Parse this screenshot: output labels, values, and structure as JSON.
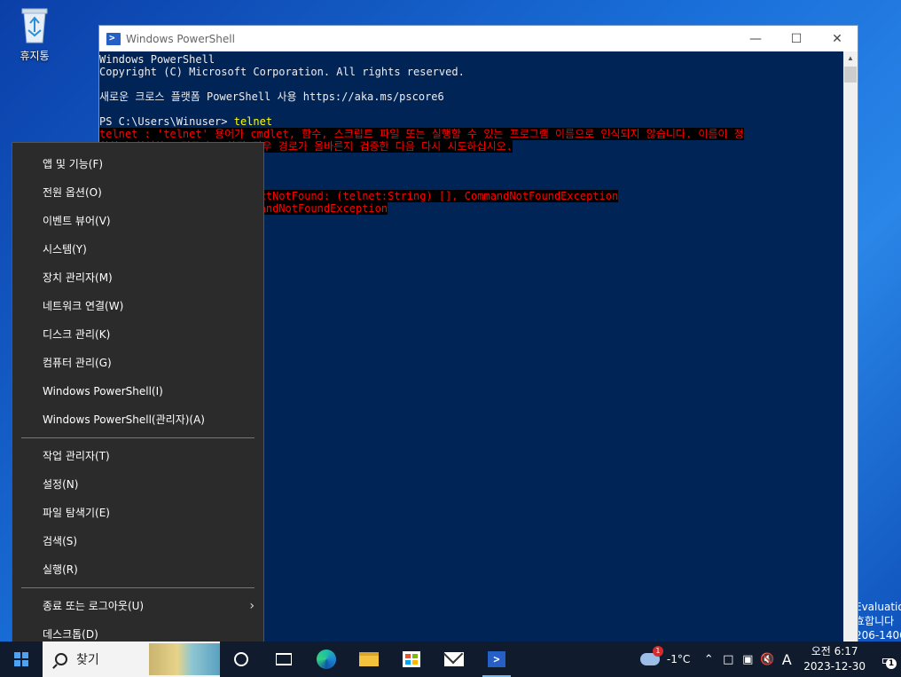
{
  "desktop": {
    "recycle_bin_label": "휴지통"
  },
  "watermark": {
    "lines": [
      "Evaluation",
      "효합니다",
      "206-1406"
    ]
  },
  "powershell": {
    "title": "Windows PowerShell",
    "console_lines": [
      {
        "text": "Windows PowerShell",
        "kind": "normal"
      },
      {
        "text": "Copyright (C) Microsoft Corporation. All rights reserved.",
        "kind": "normal"
      },
      {
        "text": "",
        "kind": "normal"
      },
      {
        "text": "새로운 크로스 플랫폼 PowerShell 사용 https://aka.ms/pscore6",
        "kind": "normal"
      },
      {
        "text": "",
        "kind": "normal"
      },
      {
        "text": "PS C:\\Users\\Winuser> ",
        "kind": "prompt",
        "command": "telnet"
      },
      {
        "text": "telnet : 'telnet' 용어가 cmdlet, 함수, 스크립트 파일 또는 실행할 수 있는 프로그램 이름으로 인식되지 않습니다. 이름이 정",
        "kind": "error"
      },
      {
        "text": "확한지 확인하고 경로가 포함된 경우 경로가 올바른지 검증한 다음 다시 시도하십시오.",
        "kind": "error"
      },
      {
        "text": "",
        "kind": "normal"
      },
      {
        "text": "",
        "kind": "normal"
      },
      {
        "text": "",
        "kind": "normal"
      },
      {
        "text": "                   : ObjectNotFound: (telnet:String) [], CommandNotFoundException",
        "kind": "error"
      },
      {
        "text": "                   : CommandNotFoundException",
        "kind": "error"
      }
    ]
  },
  "winx_menu": {
    "group1": [
      "앱 및 기능(F)",
      "전원 옵션(O)",
      "이벤트 뷰어(V)",
      "시스템(Y)",
      "장치 관리자(M)",
      "네트워크 연결(W)",
      "디스크 관리(K)",
      "컴퓨터 관리(G)",
      "Windows PowerShell(I)",
      "Windows PowerShell(관리자)(A)"
    ],
    "group2": [
      "작업 관리자(T)",
      "설정(N)",
      "파일 탐색기(E)",
      "검색(S)",
      "실행(R)"
    ],
    "group3": [
      {
        "label": "종료 또는 로그아웃(U)",
        "submenu": true
      },
      {
        "label": "데스크톱(D)",
        "submenu": false
      }
    ]
  },
  "taskbar": {
    "search_placeholder": "찾기",
    "weather_temp": "-1°C",
    "weather_badge": "1",
    "ime_label": "A",
    "clock_time": "오전 6:17",
    "clock_date": "2023-12-30",
    "notification_count": "1"
  }
}
